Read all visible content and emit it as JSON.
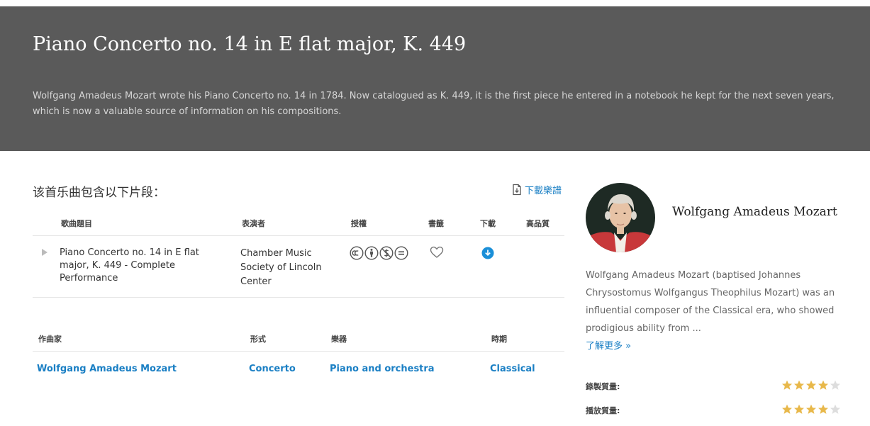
{
  "piece": {
    "title": "Piano Concerto no. 14 in E flat major, K. 449",
    "description": "Wolfgang Amadeus Mozart wrote his Piano Concerto no. 14 in 1784. Now catalogued as K. 449, it is the first piece he entered in a notebook he kept for the next seven years, which is now a valuable source of information on his compositions."
  },
  "segments": {
    "heading": "该首乐曲包含以下片段：",
    "download_score_label": "下載樂譜",
    "columns": [
      "歌曲題目",
      "表演者",
      "授權",
      "書籤",
      "下載",
      "高品質"
    ],
    "tracks": [
      {
        "title": "Piano Concerto no. 14 in E flat major, K. 449 - Complete Performance",
        "performer": "Chamber Music Society of Lincoln Center",
        "license_icons": [
          "cc-icon",
          "attribution-icon",
          "noncommercial-icon",
          "noderivatives-icon"
        ]
      }
    ]
  },
  "meta": {
    "columns": [
      "作曲家",
      "形式",
      "樂器",
      "時期"
    ],
    "values": [
      "Wolfgang Amadeus Mozart",
      "Concerto",
      "Piano and orchestra",
      "Classical"
    ]
  },
  "composer": {
    "name": "Wolfgang Amadeus Mozart",
    "bio": "Wolfgang Amadeus Mozart (baptised Johannes Chrysostomus Wolfgangus Theophilus Mozart) was an influential composer of the Classical era, who showed prodigious ability from ...",
    "learn_more": "了解更多 »"
  },
  "ratings": [
    {
      "label": "錄製質量:",
      "stars": 4,
      "max": 5
    },
    {
      "label": "播放質量:",
      "stars": 4,
      "max": 5
    }
  ],
  "colors": {
    "hero_bg": "#5a5a5a",
    "link": "#1a7fc4",
    "star_filled": "#e8b84a",
    "star_empty": "#dddddd"
  }
}
